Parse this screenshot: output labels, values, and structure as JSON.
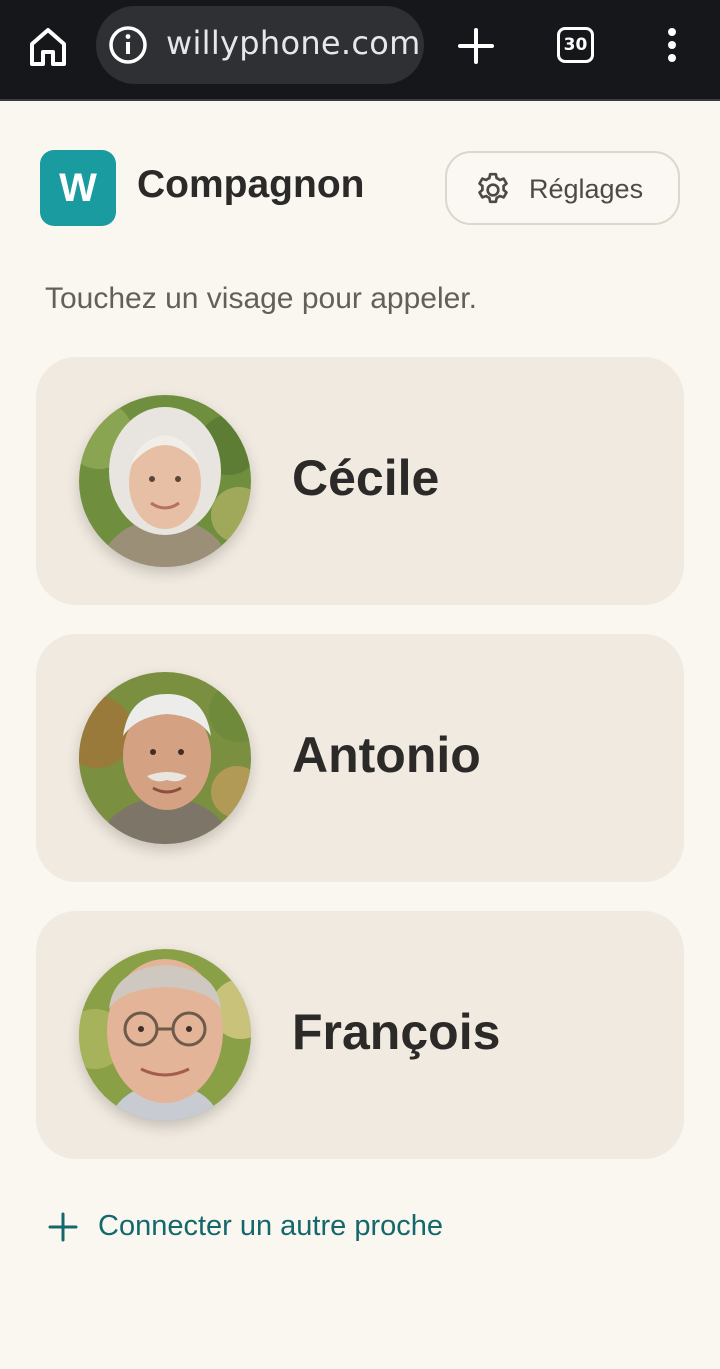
{
  "browser": {
    "url": "willyphone.com",
    "tab_count": "30"
  },
  "app": {
    "logo_letter": "W",
    "title": "Compagnon",
    "settings_label": "Réglages",
    "hint": "Touchez un visage pour appeler.",
    "accent_color": "#1a9ba0"
  },
  "contacts": [
    {
      "name": "Cécile",
      "avatar": "elderly-woman-photo"
    },
    {
      "name": "Antonio",
      "avatar": "elderly-man-mustache-photo"
    },
    {
      "name": "François",
      "avatar": "elderly-man-glasses-photo"
    }
  ],
  "connect_label": "Connecter un autre proche"
}
